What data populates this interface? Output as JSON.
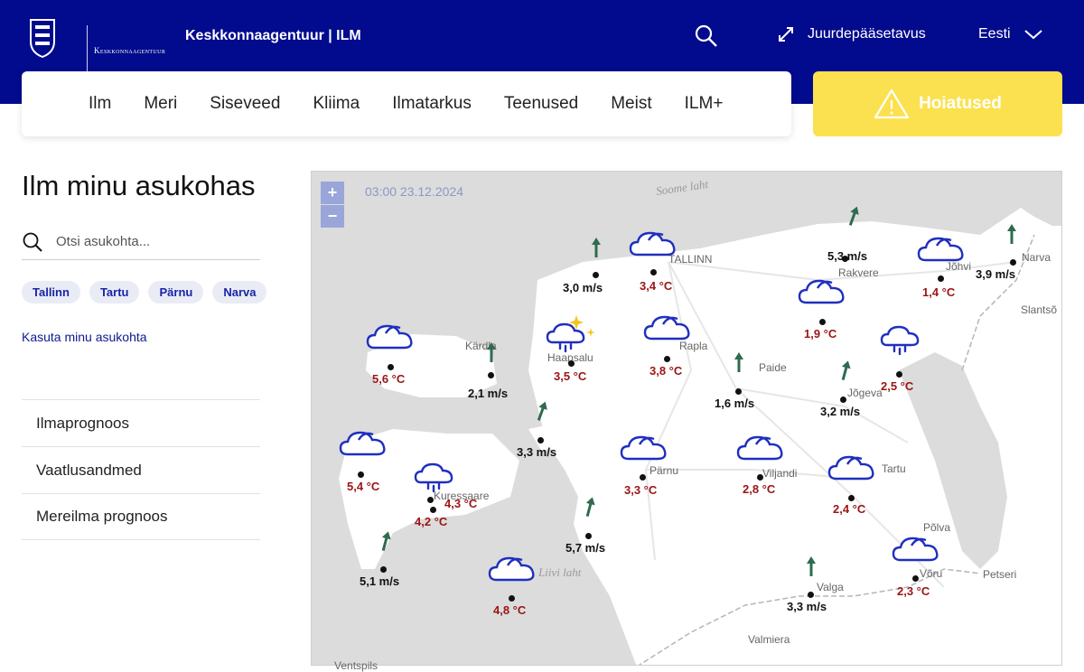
{
  "header": {
    "logo_text": "Keskkonnaagentuur",
    "site_title": "Keskkonnaagentuur | ILM",
    "accessibility": "Juurdepääsetavus",
    "language": "Eesti"
  },
  "nav": [
    "Ilm",
    "Meri",
    "Siseveed",
    "Kliima",
    "Ilmatarkus",
    "Teenused",
    "Meist",
    "ILM+"
  ],
  "warnings_button": "Hoiatused",
  "sidebar": {
    "title": "Ilm minu asukohas",
    "search_placeholder": "Otsi asukohta...",
    "chips": [
      "Tallinn",
      "Tartu",
      "Pärnu",
      "Narva"
    ],
    "use_location": "Kasuta minu asukohta",
    "menu": [
      "Ilmaprognoos",
      "Vaatlusandmed",
      "Mereilma prognoos"
    ]
  },
  "map": {
    "timestamp": "03:00 23.12.2024",
    "zoom_in": "+",
    "zoom_out": "−",
    "seas": [
      "Soome laht",
      "Liivi laht"
    ],
    "places": [
      "TALLINN",
      "Rakvere",
      "Jõhvi",
      "Narva",
      "Slantsõ",
      "Kärdla",
      "Haapsalu",
      "Rapla",
      "Paide",
      "Jõgeva",
      "Kuressaare",
      "Pärnu",
      "Viljandi",
      "Tartu",
      "Põlva",
      "Võru",
      "Valga",
      "Petseri",
      "Valmiera",
      "Ventspils"
    ],
    "temperatures": [
      "3,4 °C",
      "1,4 °C",
      "1,9 °C",
      "5,6 °C",
      "3,5 °C",
      "3,8 °C",
      "2,5 °C",
      "5,4 °C",
      "4,3 °C",
      "4,2 °C",
      "3,3 °C",
      "2,8 °C",
      "2,4 °C",
      "2,3 °C",
      "4,8 °C"
    ],
    "winds": [
      "5,3 m/s",
      "3,9 m/s",
      "3,0 m/s",
      "2,1 m/s",
      "1,6 m/s",
      "3,2 m/s",
      "3,3 m/s",
      "5,7 m/s",
      "5,1 m/s",
      "3,3 m/s"
    ]
  },
  "icons": {
    "search": "search-icon",
    "expand": "expand-arrows-icon",
    "chevron": "chevron-down-icon",
    "warning": "warning-triangle-icon",
    "cloud": "cloud-icon",
    "rain": "rain-cloud-icon",
    "sun": "partly-sunny-rain-icon",
    "wind": "wind-arrow-icon"
  },
  "colors": {
    "header": "#020b8d",
    "warning": "#fbe14f",
    "temp": "#9b1414",
    "wind_arrow": "#2e6b4f",
    "cloud": "#1f2fbf"
  }
}
